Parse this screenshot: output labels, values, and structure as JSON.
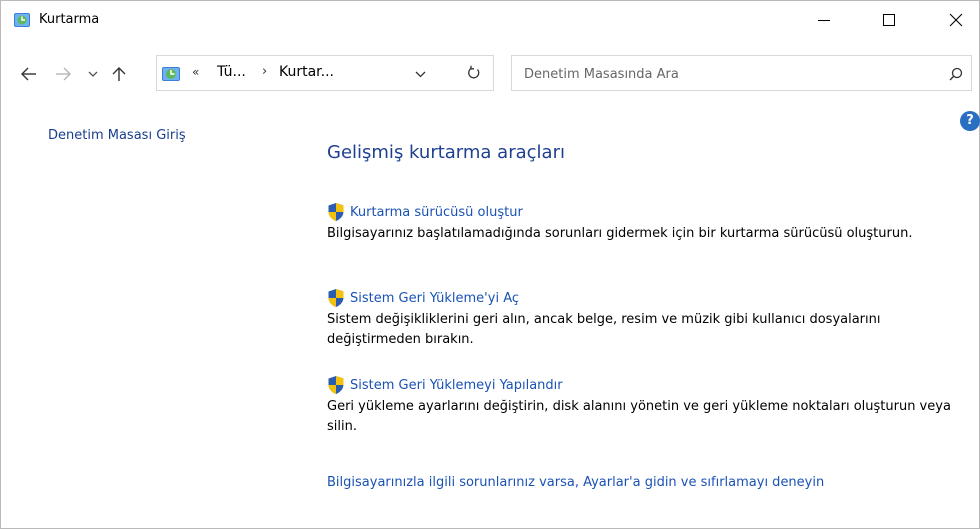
{
  "window": {
    "title": "Kurtarma",
    "icon": "control-panel-icon"
  },
  "titlebar_buttons": {
    "minimize_icon": "minimize-icon",
    "maximize_icon": "maximize-icon",
    "close_icon": "close-icon"
  },
  "nav": {
    "back_icon": "back-arrow-icon",
    "forward_icon": "forward-arrow-icon",
    "recent_icon": "chevron-down-icon",
    "up_icon": "up-arrow-icon",
    "address": {
      "overflow": "«",
      "crumbs": [
        "Tü...",
        "Kurtar..."
      ],
      "separator": "›"
    },
    "refresh_icon": "refresh-icon"
  },
  "search": {
    "placeholder": "Denetim Masasında Ara",
    "value": ""
  },
  "help": {
    "label": "?"
  },
  "sidebar": {
    "home_link": "Denetim Masası Giriş"
  },
  "main": {
    "heading": "Gelişmiş kurtarma araçları",
    "tasks": [
      {
        "link": "Kurtarma sürücüsü oluştur",
        "description": "Bilgisayarınız başlatılamadığında sorunları gidermek için bir kurtarma sürücüsü oluşturun."
      },
      {
        "link": "Sistem Geri Yükleme'yi Aç",
        "description": "Sistem değişikliklerini geri alın, ancak belge, resim ve müzik gibi kullanıcı dosyalarını değiştirmeden bırakın."
      },
      {
        "link": "Sistem Geri Yüklemeyi Yapılandır",
        "description": "Geri yükleme ayarlarını değiştirin, disk alanını yönetin ve geri yükleme noktaları oluşturun veya silin."
      }
    ],
    "settings_link": "Bilgisayarınızla ilgili sorunlarınız varsa, Ayarlar'a gidin ve sıfırlamayı deneyin"
  },
  "colors": {
    "link": "#1a52b5",
    "heading": "#1f3f8f",
    "help_badge": "#2a6fc2",
    "shield_blue": "#2a5db0",
    "shield_yellow": "#f4c20d"
  }
}
